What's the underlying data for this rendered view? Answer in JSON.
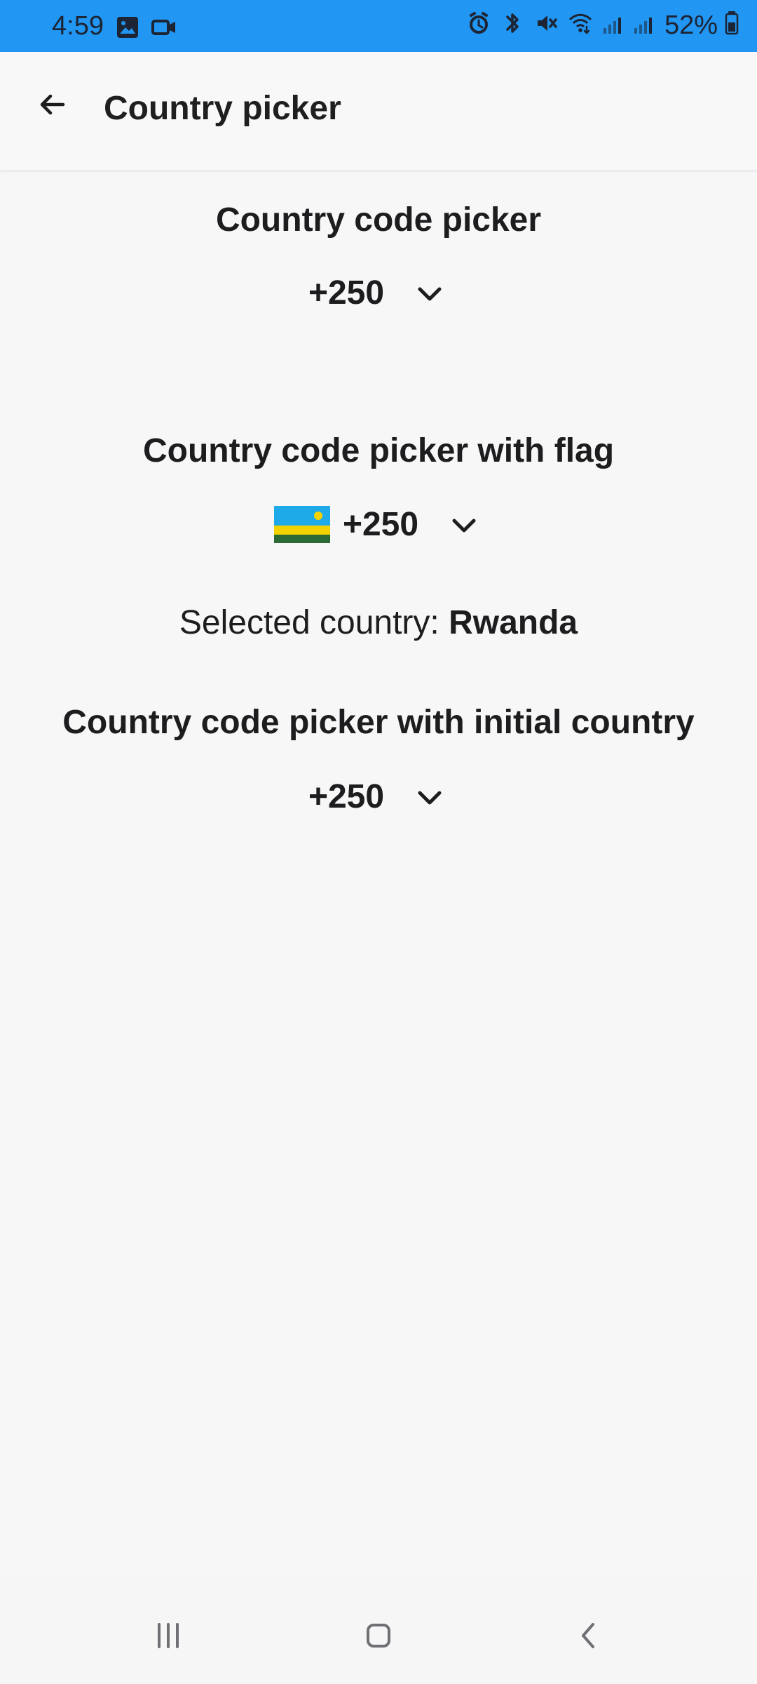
{
  "status_bar": {
    "time": "4:59",
    "battery": "52%",
    "icons_left": [
      "gallery-icon",
      "video-camera-icon"
    ],
    "icons_right": [
      "alarm-icon",
      "bluetooth-icon",
      "mute-icon",
      "wifi-icon",
      "signal-icon",
      "signal-icon",
      "battery-icon"
    ],
    "background_color": "#2196f3"
  },
  "app_bar": {
    "title": "Country picker",
    "back_icon": "back-arrow-icon"
  },
  "sections": [
    {
      "title": "Country code picker",
      "value": "+250"
    },
    {
      "title": "Country code picker with flag",
      "value": "+250",
      "flag_colors": {
        "blue": "#1ea9e8",
        "yellow": "#f2d200",
        "green": "#2b6a35",
        "sun": "#f6d300"
      }
    },
    {
      "title": "Country code picker with initial country",
      "value": "+250"
    }
  ],
  "selected_country": {
    "label": "Selected country:",
    "value": "Rwanda"
  },
  "navigation": {
    "recent_icon": "recent-apps-icon",
    "home_icon": "home-icon",
    "back_icon": "back-icon"
  }
}
